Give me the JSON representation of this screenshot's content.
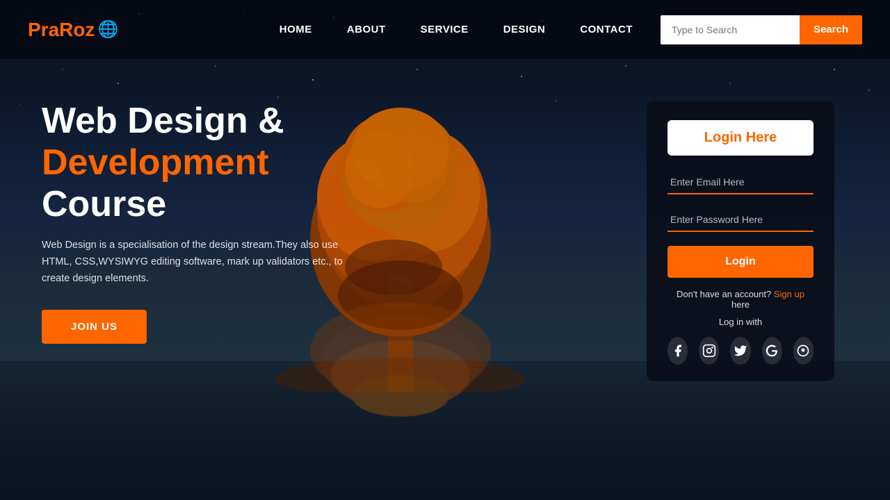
{
  "brand": {
    "name": "PraRoz",
    "globe": "🌐"
  },
  "nav": {
    "links": [
      "HOME",
      "ABOUT",
      "SERVICE",
      "DESIGN",
      "CONTACT"
    ]
  },
  "search": {
    "placeholder": "Type to Search",
    "button_label": "Search"
  },
  "hero": {
    "line1": "Web Design &",
    "line2": "Development",
    "line3": "Course",
    "description": "Web Design is a specialisation of the design stream.They also use HTML, CSS,WYSIWYG editing software, mark up validators etc., to create design elements.",
    "join_button": "JOIN US"
  },
  "login_card": {
    "title": "Login Here",
    "email_placeholder": "Enter Email Here",
    "password_placeholder": "Enter Password Here",
    "login_button": "Login",
    "no_account_text": "Don't have an account?",
    "signup_text": "Sign up",
    "here_text": "here",
    "login_with_text": "Log in with",
    "social": [
      "facebook",
      "instagram",
      "twitter",
      "google",
      "skype"
    ]
  },
  "colors": {
    "orange": "#ff6600",
    "bg_dark": "#0a0e1a",
    "card_bg": "rgba(10,14,25,0.92)"
  }
}
